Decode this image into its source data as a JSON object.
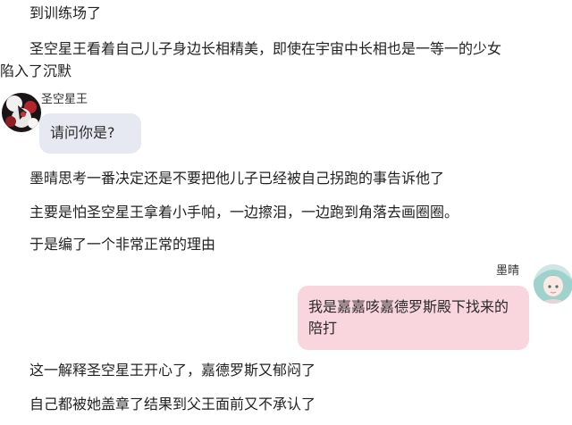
{
  "narration": {
    "top": "到训练场了",
    "para1_line1": "圣空星王看着自己儿子身边长相精美，即使在宇宙中长相也是一等一的少女",
    "para1_line2": "陷入了沉默",
    "mid1": "墨晴思考一番决定还是不要把他儿子已经被自己拐跑的事告诉他了",
    "mid2": "主要是怕圣空星王拿着小手帕，一边擦泪，一边跑到角落去画圈圈。",
    "mid3": "于是编了一个非常正常的理由",
    "bottom1": "这一解释圣空星王开心了，嘉德罗斯又郁闷了",
    "bottom2": "自己都被她盖章了结果到父王面前又不承认了"
  },
  "chat_left": {
    "name": "圣空星王",
    "message": "请问你是?"
  },
  "chat_right": {
    "name": "墨晴",
    "message": "我是嘉嘉咳嘉德罗斯殿下找来的陪打"
  },
  "colors": {
    "left_bubble": "#e6e9f2",
    "right_bubble": "#f9d5dd"
  }
}
